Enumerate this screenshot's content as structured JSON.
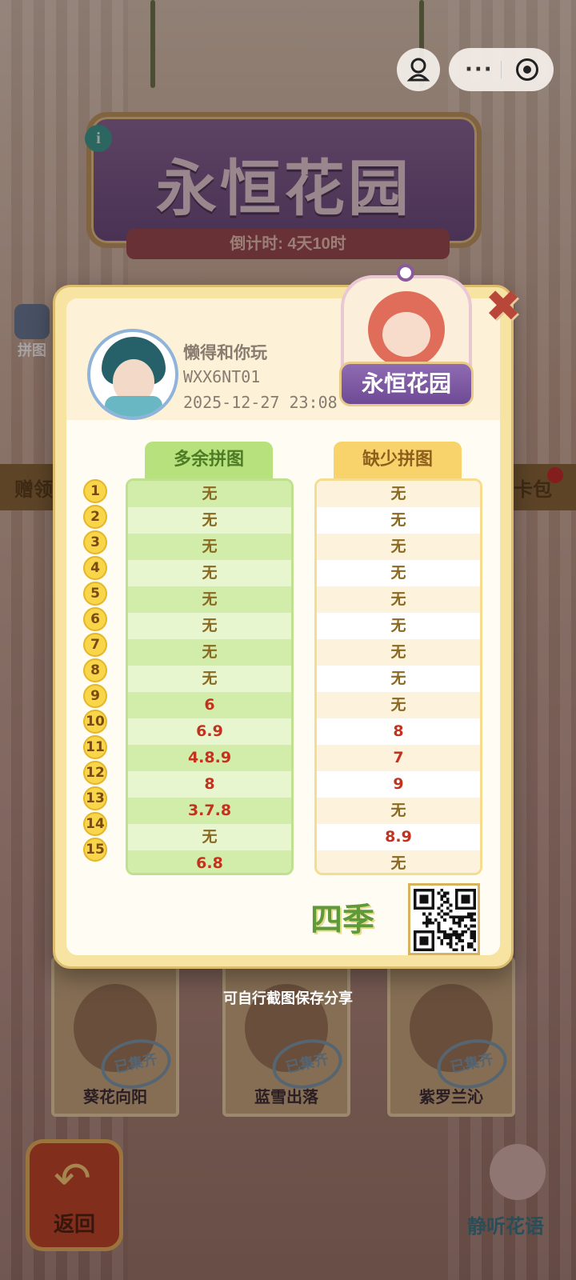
{
  "background": {
    "game_title": "永恒花园",
    "countdown": "倒计时: 4天10时",
    "info_icon": "i",
    "side_button_label": "拼图",
    "strip_left_label": "赠领",
    "strip_right_label": "卡包",
    "cards": [
      {
        "caption": "葵花向阳",
        "stamp": "已集齐"
      },
      {
        "caption": "蓝雪出落",
        "stamp": "已集齐"
      },
      {
        "caption": "紫罗兰沁",
        "stamp": "已集齐"
      }
    ],
    "back_label": "返回",
    "back_icon": "undo-arrow-icon",
    "listen_label": "静听花语"
  },
  "capsule": {
    "menu_dots": "···",
    "user_icon": "user-icon",
    "close_icon": "target-circle-icon"
  },
  "modal": {
    "user": {
      "name": "懒得和你玩",
      "id": "WXX6NT01",
      "timestamp": "2025-12-27 23:08"
    },
    "badge_logo": "永恒花园",
    "close_symbol": "✖",
    "columns": {
      "extra_header": "多余拼图",
      "missing_header": "缺少拼图"
    },
    "rows": [
      {
        "n": "1",
        "extra": "无",
        "missing": "无"
      },
      {
        "n": "2",
        "extra": "无",
        "missing": "无"
      },
      {
        "n": "3",
        "extra": "无",
        "missing": "无"
      },
      {
        "n": "4",
        "extra": "无",
        "missing": "无"
      },
      {
        "n": "5",
        "extra": "无",
        "missing": "无"
      },
      {
        "n": "6",
        "extra": "无",
        "missing": "无"
      },
      {
        "n": "7",
        "extra": "无",
        "missing": "无"
      },
      {
        "n": "8",
        "extra": "无",
        "missing": "无"
      },
      {
        "n": "9",
        "extra": "6",
        "missing": "无"
      },
      {
        "n": "10",
        "extra": "6.9",
        "missing": "8"
      },
      {
        "n": "11",
        "extra": "4.8.9",
        "missing": "7"
      },
      {
        "n": "12",
        "extra": "8",
        "missing": "9"
      },
      {
        "n": "13",
        "extra": "3.7.8",
        "missing": "无"
      },
      {
        "n": "14",
        "extra": "无",
        "missing": "8.9"
      },
      {
        "n": "15",
        "extra": "6.8",
        "missing": "无"
      }
    ],
    "brand_mark": "四季",
    "qr_icon": "qr-code-icon"
  },
  "hint": "可自行截图保存分享",
  "colors": {
    "extra_header_bg": "#b7e17c",
    "missing_header_bg": "#f8d26a",
    "value_red": "#c2321e",
    "value_green": "#6a9a2a",
    "none_color": "#8a6a22"
  }
}
